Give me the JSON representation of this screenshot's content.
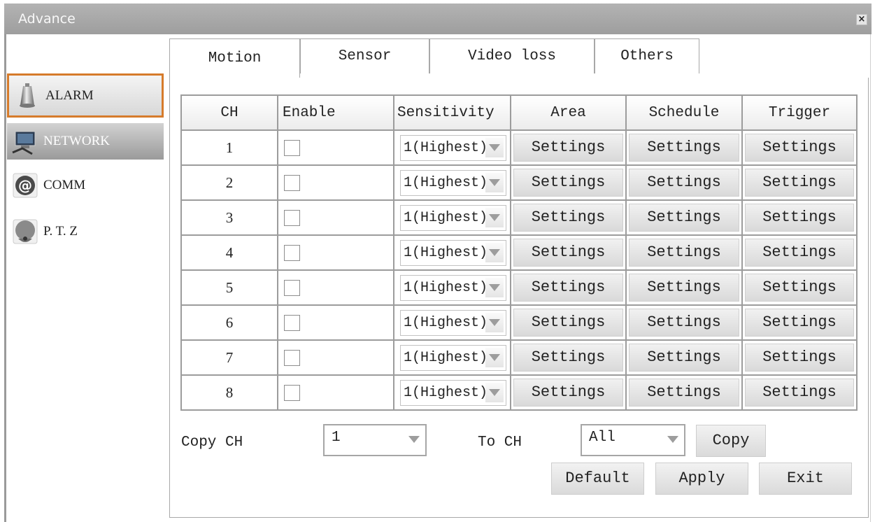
{
  "window": {
    "title": "Advance",
    "close_label": "×"
  },
  "sidebar": {
    "items": [
      {
        "label": "ALARM",
        "icon": "alarm-siren-icon"
      },
      {
        "label": "NETWORK",
        "icon": "network-computer-icon"
      },
      {
        "label": "COMM",
        "icon": "at-sign-icon"
      },
      {
        "label": "P. T. Z",
        "icon": "ptz-dome-camera-icon"
      }
    ]
  },
  "tabs": [
    "Motion",
    "Sensor",
    "Video loss",
    "Others"
  ],
  "table": {
    "headers": [
      "CH",
      "Enable",
      "Sensitivity",
      "Area",
      "Schedule",
      "Trigger"
    ],
    "rows": [
      {
        "ch": "1",
        "sensitivity": "1(Highest)",
        "area": "Settings",
        "schedule": "Settings",
        "trigger": "Settings"
      },
      {
        "ch": "2",
        "sensitivity": "1(Highest)",
        "area": "Settings",
        "schedule": "Settings",
        "trigger": "Settings"
      },
      {
        "ch": "3",
        "sensitivity": "1(Highest)",
        "area": "Settings",
        "schedule": "Settings",
        "trigger": "Settings"
      },
      {
        "ch": "4",
        "sensitivity": "1(Highest)",
        "area": "Settings",
        "schedule": "Settings",
        "trigger": "Settings"
      },
      {
        "ch": "5",
        "sensitivity": "1(Highest)",
        "area": "Settings",
        "schedule": "Settings",
        "trigger": "Settings"
      },
      {
        "ch": "6",
        "sensitivity": "1(Highest)",
        "area": "Settings",
        "schedule": "Settings",
        "trigger": "Settings"
      },
      {
        "ch": "7",
        "sensitivity": "1(Highest)",
        "area": "Settings",
        "schedule": "Settings",
        "trigger": "Settings"
      },
      {
        "ch": "8",
        "sensitivity": "1(Highest)",
        "area": "Settings",
        "schedule": "Settings",
        "trigger": "Settings"
      }
    ]
  },
  "copy": {
    "from_label": "Copy CH",
    "from_value": "1",
    "to_label": "To CH",
    "to_value": "All",
    "button": "Copy"
  },
  "footer": {
    "default": "Default",
    "apply": "Apply",
    "exit": "Exit"
  },
  "colors": {
    "active_border": "#d67b2b",
    "titlebar": "#a8a8a8"
  }
}
